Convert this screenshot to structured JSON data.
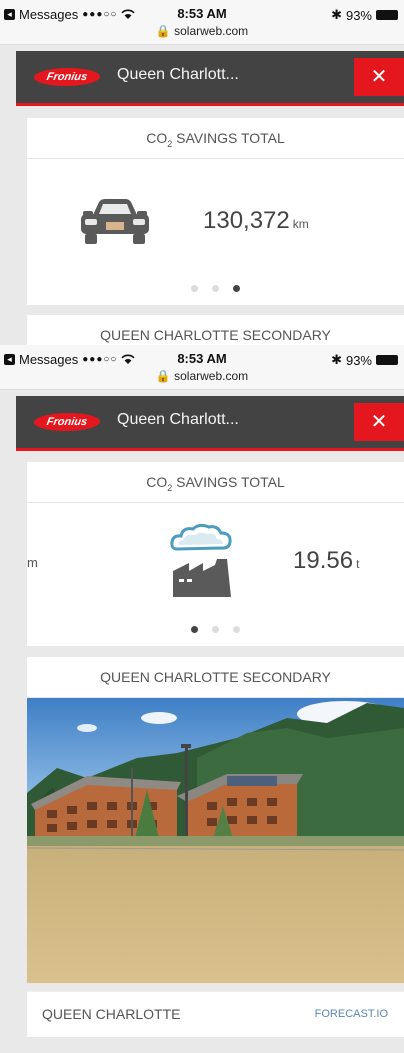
{
  "status": {
    "carrier": "Messages",
    "signal_dots": "●●●○○",
    "wifi_icon": "wifi-icon",
    "time": "8:53 AM",
    "bluetooth": "✱",
    "battery": "93%",
    "lock_icon": "lock-icon",
    "url": "solarweb.com"
  },
  "appbar": {
    "logo": "Fronius",
    "title": "Queen Charlott...",
    "close": "✕"
  },
  "savings": {
    "title_prefix": "CO",
    "title_sub": "2",
    "title_suffix": " SAVINGS TOTAL",
    "car": {
      "value": "130,372",
      "unit": "km"
    },
    "factory": {
      "value": "19.56",
      "unit": "t"
    },
    "clipped_unit": "m",
    "pager_count": 3
  },
  "site": {
    "name": "QUEEN CHARLOTTE SECONDARY",
    "location": "QUEEN CHARLOTTE",
    "forecast_link": "FORECAST.IO"
  },
  "colors": {
    "accent": "#e3171d",
    "header": "#434343",
    "link": "#5b87b8"
  }
}
